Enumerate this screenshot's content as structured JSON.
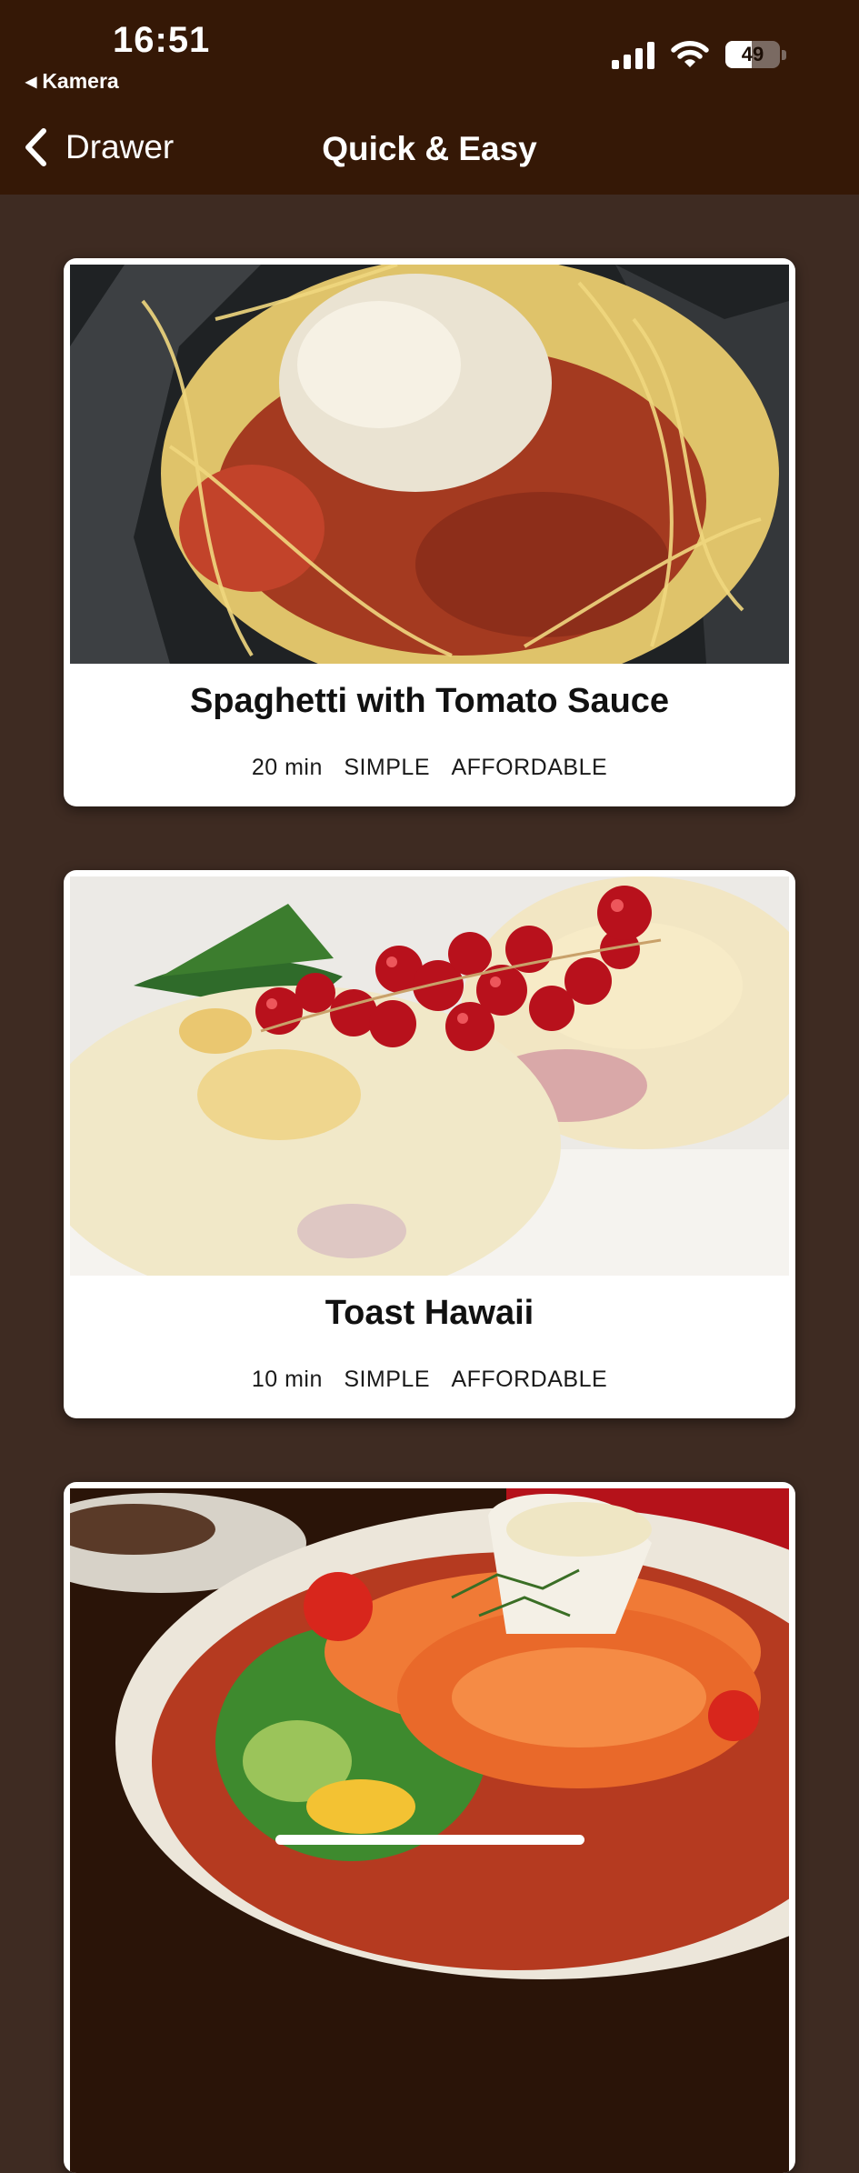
{
  "status": {
    "time": "16:51",
    "back_app": "Kamera",
    "battery": "49",
    "battery_level": 0.49
  },
  "nav": {
    "back_label": "Drawer",
    "title": "Quick & Easy"
  },
  "meals": [
    {
      "title": "Spaghetti with Tomato Sauce",
      "duration": "20 min",
      "complexity": "SIMPLE",
      "affordability": "AFFORDABLE"
    },
    {
      "title": "Toast Hawaii",
      "duration": "10 min",
      "complexity": "SIMPLE",
      "affordability": "AFFORDABLE"
    }
  ],
  "colors": {
    "header": "#351806",
    "background": "#3e2b22",
    "card": "#ffffff"
  }
}
